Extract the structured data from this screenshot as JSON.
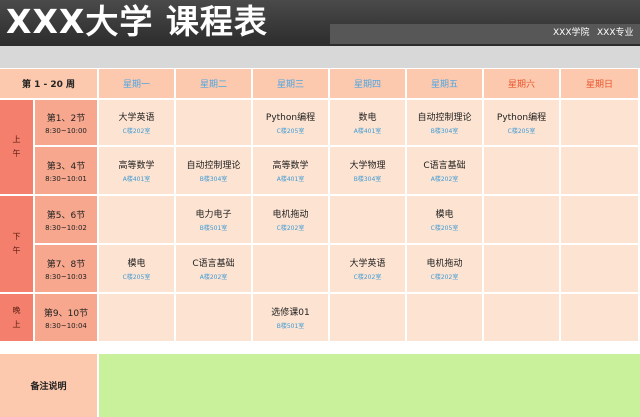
{
  "header": {
    "title": "XXX大学  课程表",
    "school": "XXX学院",
    "major": "XXX专业"
  },
  "table": {
    "week_label": "第 1 - 20 周",
    "days": [
      {
        "label": "星期一",
        "weekend": false
      },
      {
        "label": "星期二",
        "weekend": false
      },
      {
        "label": "星期三",
        "weekend": false
      },
      {
        "label": "星期四",
        "weekend": false
      },
      {
        "label": "星期五",
        "weekend": false
      },
      {
        "label": "星期六",
        "weekend": true
      },
      {
        "label": "星期日",
        "weekend": true
      }
    ],
    "sessions": [
      {
        "label": "上\n午",
        "rows": [
          0,
          1
        ]
      },
      {
        "label": "下\n午",
        "rows": [
          2,
          3
        ]
      },
      {
        "label": "晚\n上",
        "rows": [
          4
        ]
      }
    ],
    "periods": [
      {
        "name": "第1、2节",
        "time": "8:30~10:00"
      },
      {
        "name": "第3、4节",
        "time": "8:30~10:01"
      },
      {
        "name": "第5、6节",
        "time": "8:30~10:02"
      },
      {
        "name": "第7、8节",
        "time": "8:30~10:03"
      },
      {
        "name": "第9、10节",
        "time": "8:30~10:04"
      }
    ],
    "courses": [
      [
        {
          "name": "大学英语",
          "room": "C楼202室"
        },
        null,
        {
          "name": "Python编程",
          "room": "C楼205室"
        },
        {
          "name": "数电",
          "room": "A楼401室"
        },
        {
          "name": "自动控制理论",
          "room": "B楼304室"
        },
        {
          "name": "Python编程",
          "room": "C楼205室"
        },
        null
      ],
      [
        {
          "name": "高等数学",
          "room": "A楼401室"
        },
        {
          "name": "自动控制理论",
          "room": "B楼304室"
        },
        {
          "name": "高等数学",
          "room": "A楼401室"
        },
        {
          "name": "大学物理",
          "room": "B楼304室"
        },
        {
          "name": "C语言基础",
          "room": "A楼202室"
        },
        null,
        null
      ],
      [
        null,
        {
          "name": "电力电子",
          "room": "B楼501室"
        },
        {
          "name": "电机拖动",
          "room": "C楼202室"
        },
        null,
        {
          "name": "模电",
          "room": "C楼205室"
        },
        null,
        null
      ],
      [
        {
          "name": "模电",
          "room": "C楼205室"
        },
        {
          "name": "C语言基础",
          "room": "A楼202室"
        },
        null,
        {
          "name": "大学英语",
          "room": "C楼202室"
        },
        {
          "name": "电机拖动",
          "room": "C楼202室"
        },
        null,
        null
      ],
      [
        null,
        null,
        {
          "name": "选修课01",
          "room": "B楼501室"
        },
        null,
        null,
        null,
        null
      ]
    ]
  },
  "remarks": {
    "label": "备注说明"
  }
}
